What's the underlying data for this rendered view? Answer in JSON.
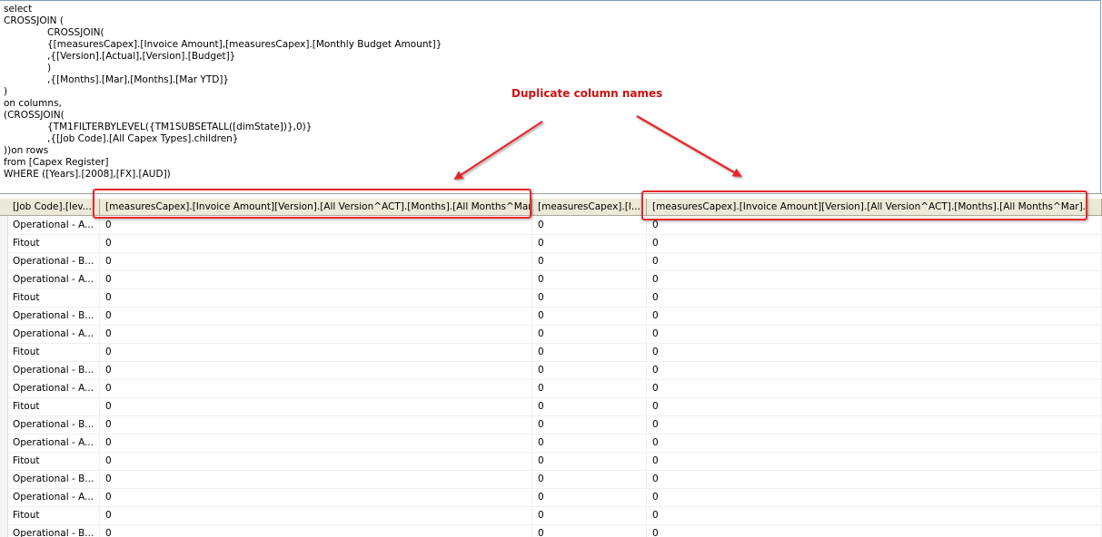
{
  "query_lines": [
    "select",
    "CROSSJOIN (",
    "CROSSJOIN(",
    "{[measuresCapex].[Invoice Amount],[measuresCapex].[Monthly Budget Amount]}",
    ",{[Version].[Actual],[Version].[Budget]}",
    ")",
    ",{[Months].[Mar],[Months].[Mar YTD]}",
    ")",
    "on columns,",
    "(CROSSJOIN(",
    "{TM1FILTERBYLEVEL({TM1SUBSETALL([dimState])},0)}",
    ",{[Job Code].[All Capex Types].children}",
    "))on rows",
    "from [Capex Register]",
    "WHERE ([Years].[2008],[FX].[AUD])"
  ],
  "annotation": {
    "text": "Duplicate column names",
    "color": "#e8282b"
  },
  "grid": {
    "columns": [
      "[Job Code].[lev...",
      "[measuresCapex].[Invoice Amount][Version].[All Version^ACT].[Months].[All Months^Mar].",
      "[measuresCapex].[I...",
      "[measuresCapex].[Invoice Amount][Version].[All Version^ACT].[Months].[All Months^Mar]."
    ],
    "rows": [
      [
        "Operational - A...",
        "0",
        "0",
        "0"
      ],
      [
        "Fitout",
        "0",
        "0",
        "0"
      ],
      [
        "Operational - B...",
        "0",
        "0",
        "0"
      ],
      [
        "Operational - A...",
        "0",
        "0",
        "0"
      ],
      [
        "Fitout",
        "0",
        "0",
        "0"
      ],
      [
        "Operational - B...",
        "0",
        "0",
        "0"
      ],
      [
        "Operational - A...",
        "0",
        "0",
        "0"
      ],
      [
        "Fitout",
        "0",
        "0",
        "0"
      ],
      [
        "Operational - B...",
        "0",
        "0",
        "0"
      ],
      [
        "Operational - A...",
        "0",
        "0",
        "0"
      ],
      [
        "Fitout",
        "0",
        "0",
        "0"
      ],
      [
        "Operational - B...",
        "0",
        "0",
        "0"
      ],
      [
        "Operational - A...",
        "0",
        "0",
        "0"
      ],
      [
        "Fitout",
        "0",
        "0",
        "0"
      ],
      [
        "Operational - B...",
        "0",
        "0",
        "0"
      ],
      [
        "Operational - A...",
        "0",
        "0",
        "0"
      ],
      [
        "Fitout",
        "0",
        "0",
        "0"
      ],
      [
        "Operational - B...",
        "0",
        "0",
        "0"
      ]
    ]
  }
}
